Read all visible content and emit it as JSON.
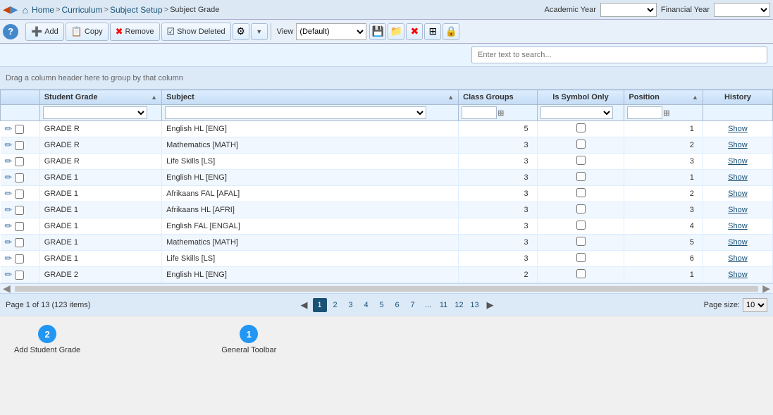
{
  "topBar": {
    "breadcrumb": [
      "Home",
      "Curriculum",
      "Subject Setup",
      "Subject Grade"
    ],
    "academicYearLabel": "Academic Year",
    "financialYearLabel": "Financial Year"
  },
  "toolbar": {
    "addLabel": "Add",
    "copyLabel": "Copy",
    "removeLabel": "Remove",
    "showDeletedLabel": "Show Deleted",
    "viewLabel": "View",
    "viewDefault": "(Default)"
  },
  "search": {
    "placeholder": "Enter text to search..."
  },
  "groupBy": {
    "text": "Drag a column header here to group by that column"
  },
  "table": {
    "columns": [
      "",
      "Student Grade",
      "Subject",
      "Class Groups",
      "Is Symbol Only",
      "Position",
      "History"
    ],
    "rows": [
      {
        "studentGrade": "GRADE R",
        "subject": "English HL [ENG]",
        "classGroups": 5,
        "isSymbolOnly": false,
        "position": 1,
        "history": "Show"
      },
      {
        "studentGrade": "GRADE R",
        "subject": "Mathematics [MATH]",
        "classGroups": 3,
        "isSymbolOnly": false,
        "position": 2,
        "history": "Show"
      },
      {
        "studentGrade": "GRADE R",
        "subject": "Life Skills [LS]",
        "classGroups": 3,
        "isSymbolOnly": false,
        "position": 3,
        "history": "Show"
      },
      {
        "studentGrade": "GRADE 1",
        "subject": "English HL [ENG]",
        "classGroups": 3,
        "isSymbolOnly": false,
        "position": 1,
        "history": "Show"
      },
      {
        "studentGrade": "GRADE 1",
        "subject": "Afrikaans FAL [AFAL]",
        "classGroups": 3,
        "isSymbolOnly": false,
        "position": 2,
        "history": "Show"
      },
      {
        "studentGrade": "GRADE 1",
        "subject": "Afrikaans HL [AFRI]",
        "classGroups": 3,
        "isSymbolOnly": false,
        "position": 3,
        "history": "Show"
      },
      {
        "studentGrade": "GRADE 1",
        "subject": "English FAL [ENGAL]",
        "classGroups": 3,
        "isSymbolOnly": false,
        "position": 4,
        "history": "Show"
      },
      {
        "studentGrade": "GRADE 1",
        "subject": "Mathematics [MATH]",
        "classGroups": 3,
        "isSymbolOnly": false,
        "position": 5,
        "history": "Show"
      },
      {
        "studentGrade": "GRADE 1",
        "subject": "Life Skills [LS]",
        "classGroups": 3,
        "isSymbolOnly": false,
        "position": 6,
        "history": "Show"
      },
      {
        "studentGrade": "GRADE 2",
        "subject": "English HL [ENG]",
        "classGroups": 2,
        "isSymbolOnly": false,
        "position": 1,
        "history": "Show"
      }
    ]
  },
  "pagination": {
    "pageInfo": "Page 1 of 13 (123 items)",
    "pages": [
      "1",
      "2",
      "3",
      "4",
      "5",
      "6",
      "7",
      "...",
      "11",
      "12",
      "13"
    ],
    "currentPage": "1",
    "pageSizeLabel": "Page size:",
    "pageSize": "10"
  },
  "tooltips": [
    {
      "number": "2",
      "label": "Add Student Grade"
    },
    {
      "number": "1",
      "label": "General Toolbar"
    }
  ]
}
